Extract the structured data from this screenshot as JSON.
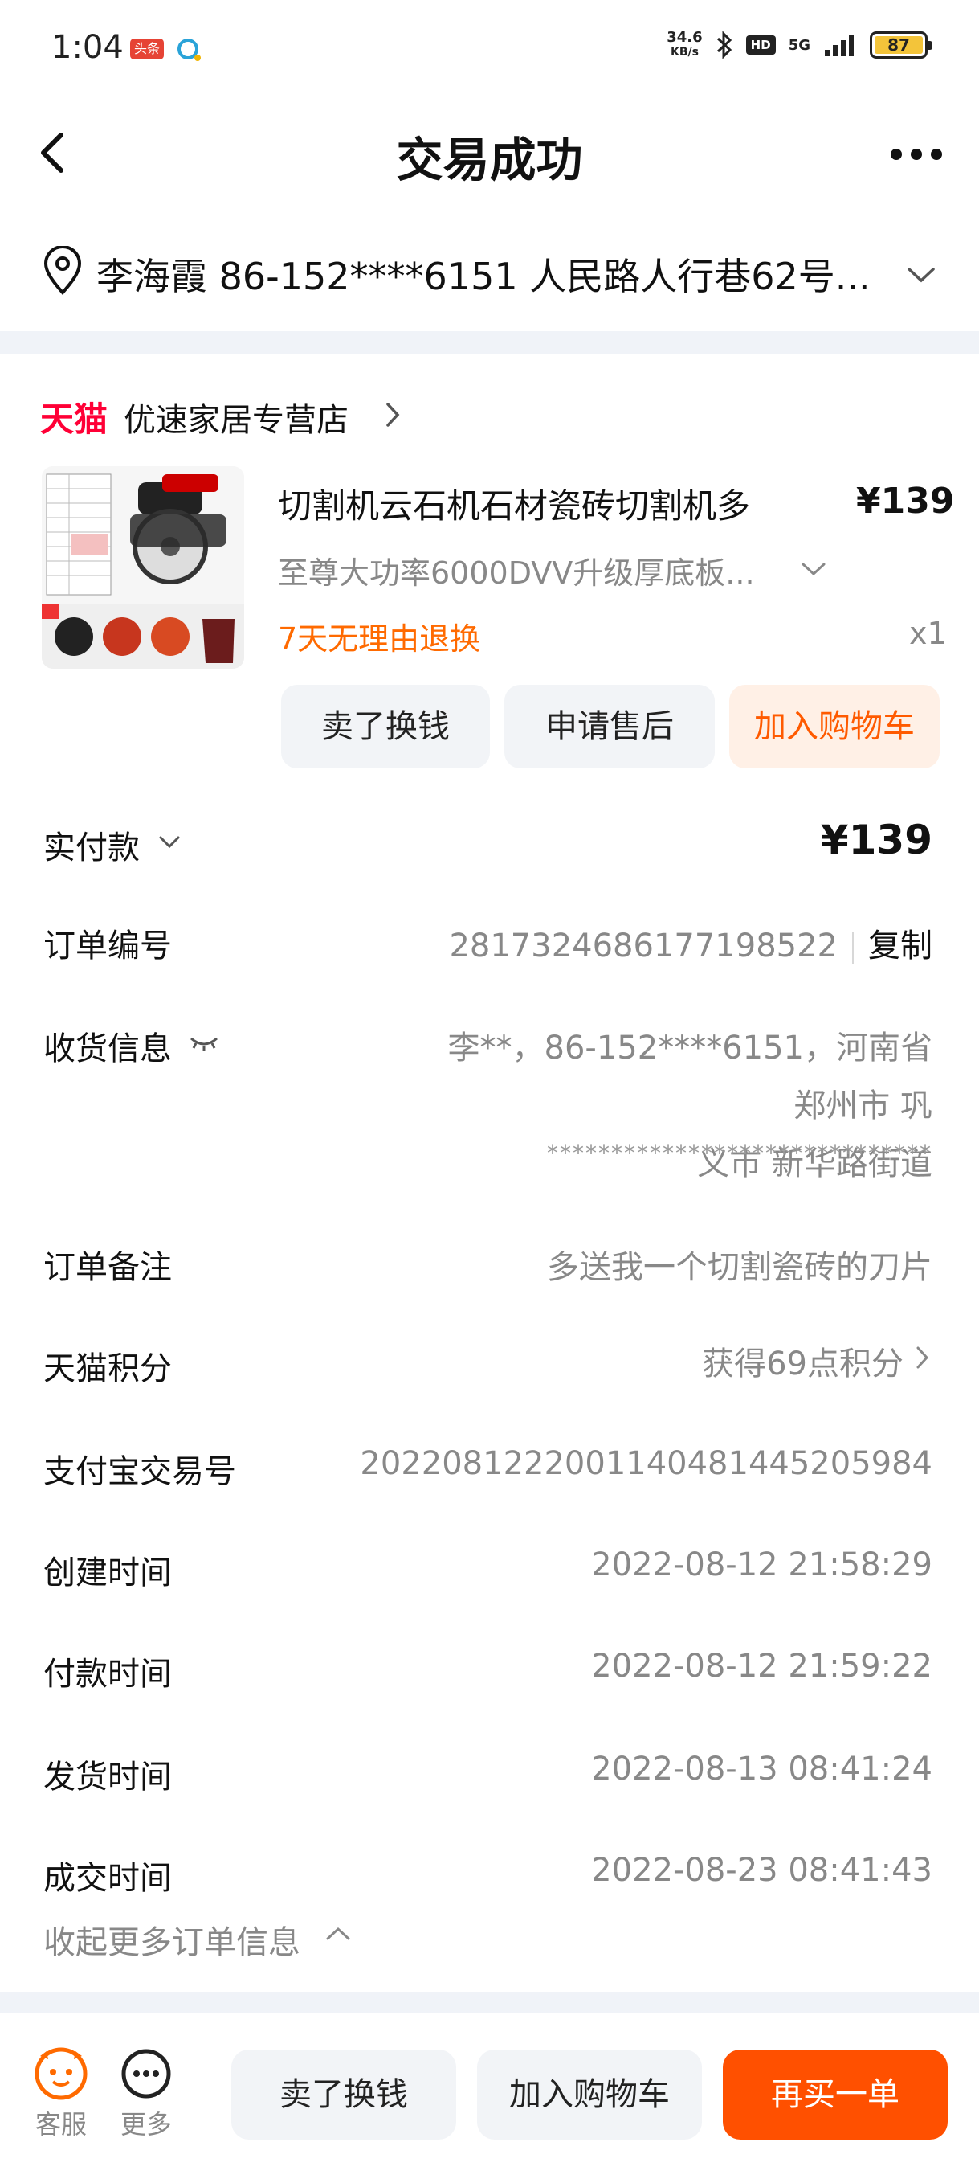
{
  "status_bar": {
    "time": "1:04",
    "app_badge": "头条",
    "net_speed_top": "34.6",
    "net_speed_bottom": "KB/s",
    "hd": "HD",
    "network": "5G",
    "battery": "87"
  },
  "header": {
    "title": "交易成功"
  },
  "address_bar": {
    "text": "李海霞  86-152****6151  人民路人行巷62号..."
  },
  "shop": {
    "platform": "天猫",
    "name": "优速家居专营店"
  },
  "product": {
    "title": "切割机云石机石材瓷砖切割机多",
    "price": "¥139",
    "sku": "至尊大功率6000DVV升级厚底板...",
    "return_policy": "7天无理由退换",
    "quantity": "x1",
    "actions": [
      "卖了换钱",
      "申请售后",
      "加入购物车"
    ]
  },
  "order": {
    "paid_label": "实付款",
    "paid_value": "¥139",
    "order_no_label": "订单编号",
    "order_no_value": "2817324686177198522",
    "copy_label": "复制",
    "shipping_label": "收货信息",
    "shipping_line1": "李**，86-152****6151，河南省 郑州市 巩",
    "shipping_line2": "义市 新华路街道",
    "shipping_line3": "******************************",
    "note_label": "订单备注",
    "note_value": "多送我一个切割瓷砖的刀片",
    "points_label": "天猫积分",
    "points_value": "获得69点积分",
    "alipay_label": "支付宝交易号",
    "alipay_value": "2022081222001140481445205984",
    "created_label": "创建时间",
    "created_value": "2022-08-12 21:58:29",
    "paid_time_label": "付款时间",
    "paid_time_value": "2022-08-12 21:59:22",
    "shipped_label": "发货时间",
    "shipped_value": "2022-08-13 08:41:24",
    "deal_label": "成交时间",
    "deal_value": "2022-08-23 08:41:43",
    "collapse_label": "收起更多订单信息"
  },
  "bottom_bar": {
    "service_label": "客服",
    "more_label": "更多",
    "sell_label": "卖了换钱",
    "cart_label": "加入购物车",
    "rebuy_label": "再买一单"
  },
  "colors": {
    "accent": "#ff5000",
    "tmall_red": "#ff0036",
    "return_orange": "#ff6a00"
  }
}
